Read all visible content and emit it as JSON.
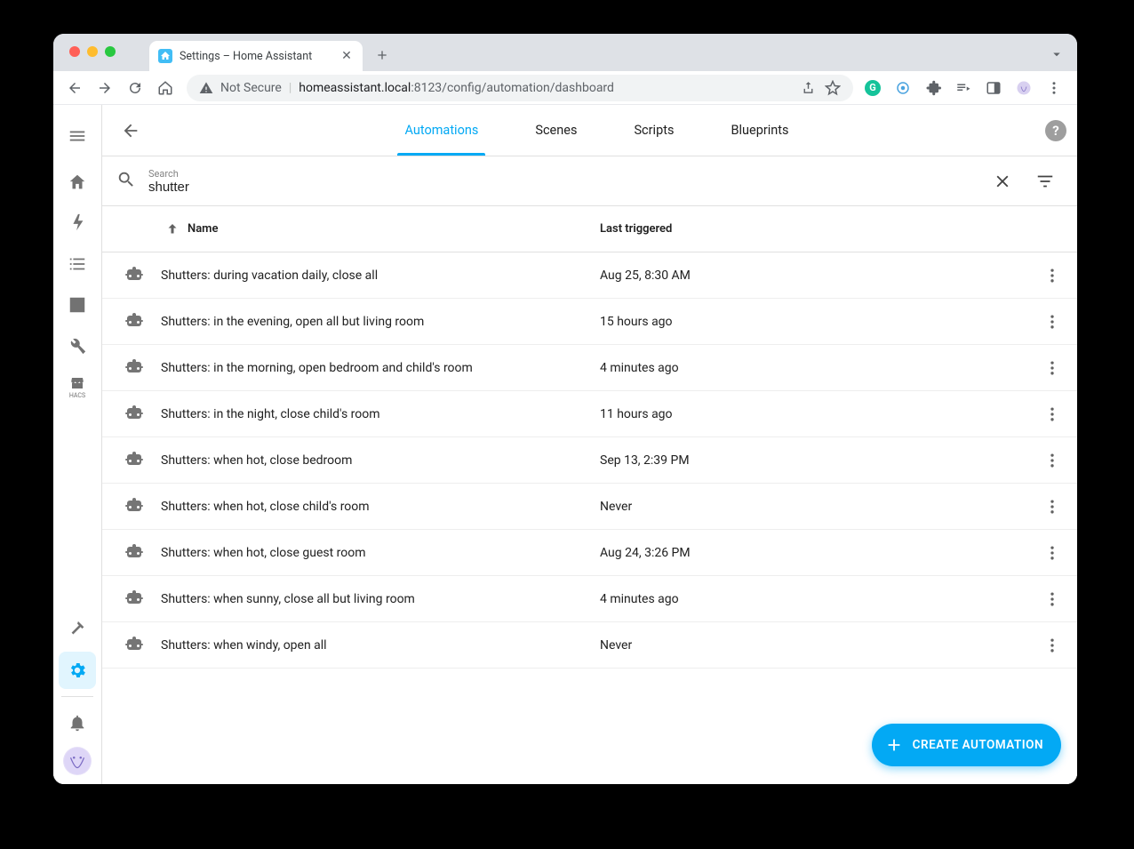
{
  "browser": {
    "tab_title": "Settings – Home Assistant",
    "not_secure_label": "Not Secure",
    "url_host": "homeassistant.local",
    "url_port_path": ":8123/config/automation/dashboard"
  },
  "tabs": {
    "automations": "Automations",
    "scenes": "Scenes",
    "scripts": "Scripts",
    "blueprints": "Blueprints"
  },
  "search": {
    "label": "Search",
    "value": "shutter"
  },
  "columns": {
    "name": "Name",
    "last_triggered": "Last triggered"
  },
  "automations": [
    {
      "name": "Shutters: during vacation daily, close all",
      "last_triggered": "Aug 25, 8:30 AM"
    },
    {
      "name": "Shutters: in the evening, open all but living room",
      "last_triggered": "15 hours ago"
    },
    {
      "name": "Shutters: in the morning, open bedroom and child's room",
      "last_triggered": "4 minutes ago"
    },
    {
      "name": "Shutters: in the night, close child's room",
      "last_triggered": "11 hours ago"
    },
    {
      "name": "Shutters: when hot, close bedroom",
      "last_triggered": "Sep 13, 2:39 PM"
    },
    {
      "name": "Shutters: when hot, close child's room",
      "last_triggered": "Never"
    },
    {
      "name": "Shutters: when hot, close guest room",
      "last_triggered": "Aug 24, 3:26 PM"
    },
    {
      "name": "Shutters: when sunny, close all but living room",
      "last_triggered": "4 minutes ago"
    },
    {
      "name": "Shutters: when windy, open all",
      "last_triggered": "Never"
    }
  ],
  "fab_label": "CREATE AUTOMATION",
  "hacs_label": "HACS"
}
